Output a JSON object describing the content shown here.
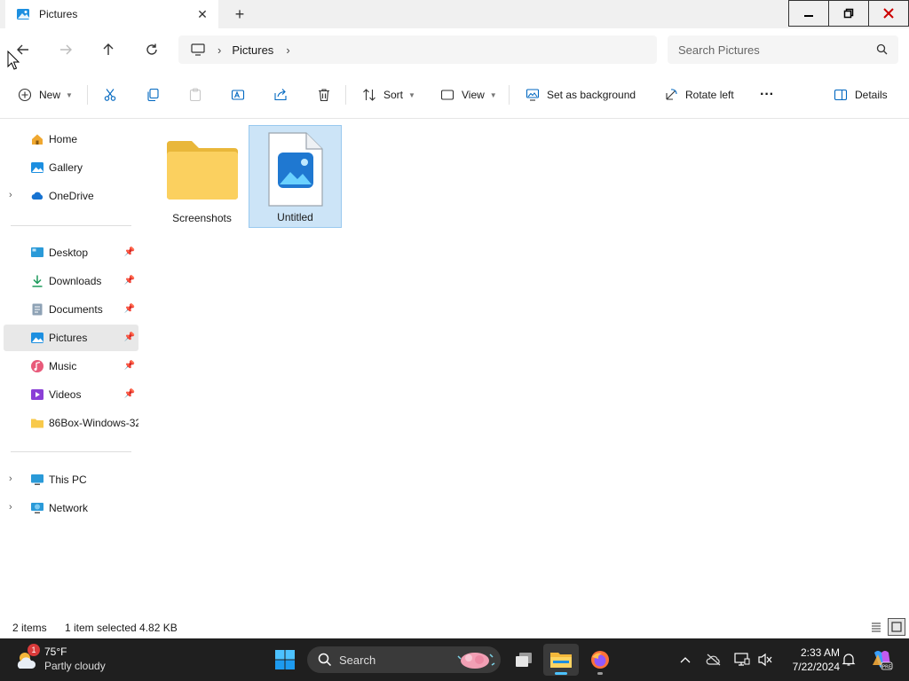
{
  "window": {
    "tab_title": "Pictures",
    "new_tab_label": "+"
  },
  "address": {
    "segments": [
      "Pictures"
    ],
    "search_placeholder": "Search Pictures"
  },
  "commands": {
    "new": "New",
    "sort": "Sort",
    "view": "View",
    "set_background": "Set as background",
    "rotate_left": "Rotate left",
    "more": "···",
    "details": "Details"
  },
  "nav": {
    "home": "Home",
    "gallery": "Gallery",
    "onedrive": "OneDrive",
    "desktop": "Desktop",
    "downloads": "Downloads",
    "documents": "Documents",
    "pictures": "Pictures",
    "music": "Music",
    "videos": "Videos",
    "folder86": "86Box-Windows-32",
    "thispc": "This PC",
    "network": "Network"
  },
  "files": [
    {
      "name": "Screenshots",
      "type": "folder"
    },
    {
      "name": "Untitled",
      "type": "image"
    }
  ],
  "status": {
    "count": "2 items",
    "selection": "1 item selected  4.82 KB"
  },
  "taskbar": {
    "temperature": "75°F",
    "condition": "Partly cloudy",
    "weather_badge": "1",
    "search_label": "Search",
    "time": "2:33 AM",
    "date": "7/22/2024"
  },
  "colors": {
    "accent": "#0067c0",
    "selection_bg": "#cce4f7",
    "folder_yellow": "#f8c94a",
    "taskbar_bg": "#1f1f1f"
  }
}
